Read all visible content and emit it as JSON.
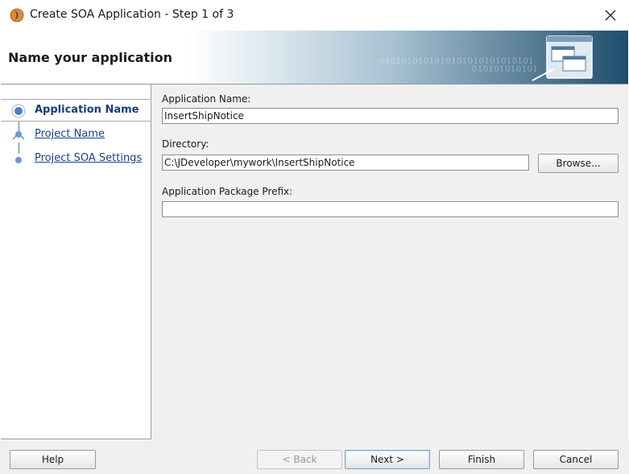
{
  "window": {
    "title": "Create SOA Application - Step 1 of 3",
    "close_glyph": "✕",
    "icon": "jdeveloper-icon"
  },
  "header": {
    "title": "Name your application",
    "decoration_1": "0101010101010101010101010101",
    "decoration_2": "010101010101"
  },
  "nav": {
    "items": [
      {
        "label": "Application Name",
        "active": true
      },
      {
        "label": "Project Name",
        "active": false
      },
      {
        "label": "Project SOA Settings",
        "active": false
      }
    ]
  },
  "form": {
    "app_name": {
      "label": "Application Name:",
      "value": "InsertShipNotice"
    },
    "directory": {
      "label": "Directory:",
      "value": "C:\\JDeveloper\\mywork\\InsertShipNotice"
    },
    "browse_label": "Browse...",
    "package_prefix": {
      "label": "Application Package Prefix:",
      "value": ""
    }
  },
  "footer": {
    "help_label": "Help",
    "back_label": "< Back",
    "next_label": "Next >",
    "finish_label": "Finish",
    "cancel_label": "Cancel"
  },
  "colors": {
    "accent": "#1b3f8c",
    "banner_dark": "#1f4d6c",
    "panel_bg": "#f0f0f0"
  }
}
